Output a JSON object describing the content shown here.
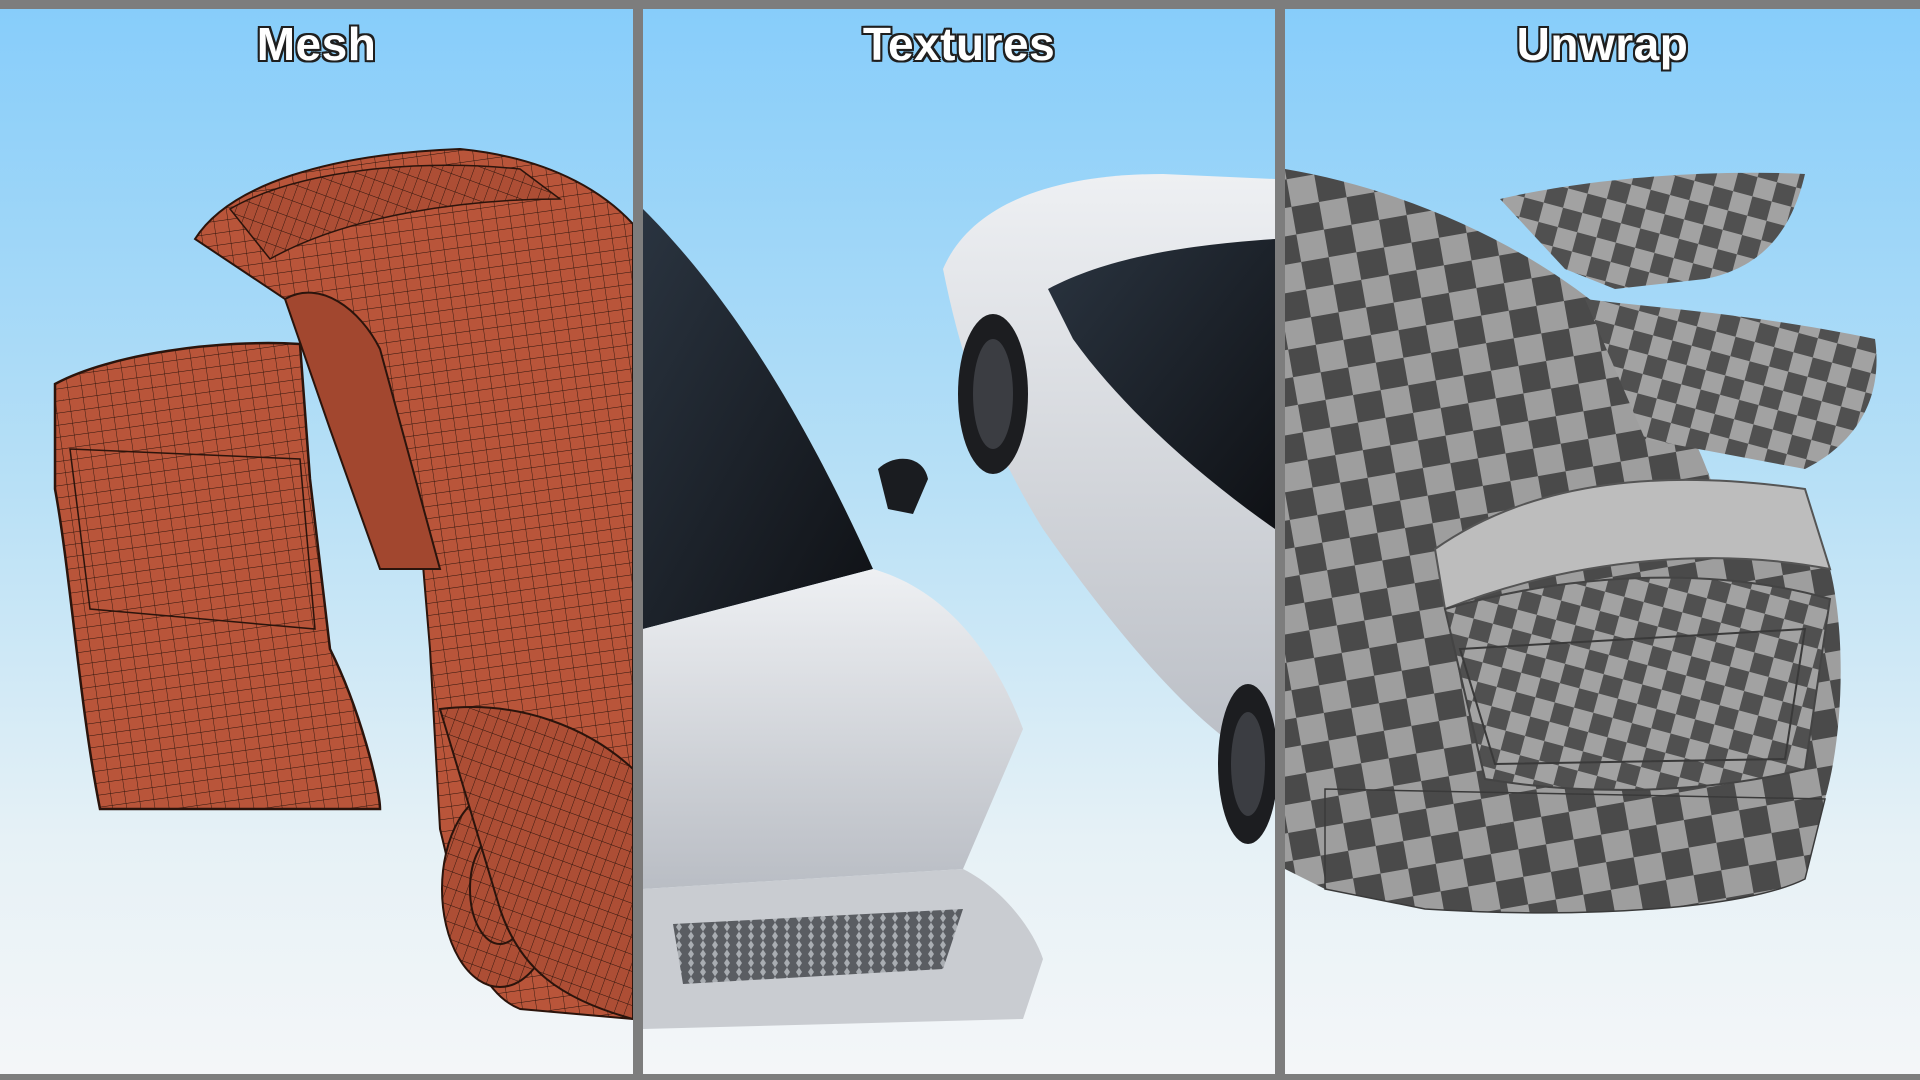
{
  "panels": [
    {
      "title": "Mesh"
    },
    {
      "title": "Textures"
    },
    {
      "title": "Unwrap"
    }
  ],
  "colors": {
    "divider": "#7d7d7d",
    "sky_top": "#87cdfa",
    "sky_bottom": "#f4f6f8",
    "mesh_fill": "#b9553a",
    "paint": "#d6d9de",
    "checker_dark": "#4a4a4a",
    "checker_light": "#9c9c9c"
  }
}
